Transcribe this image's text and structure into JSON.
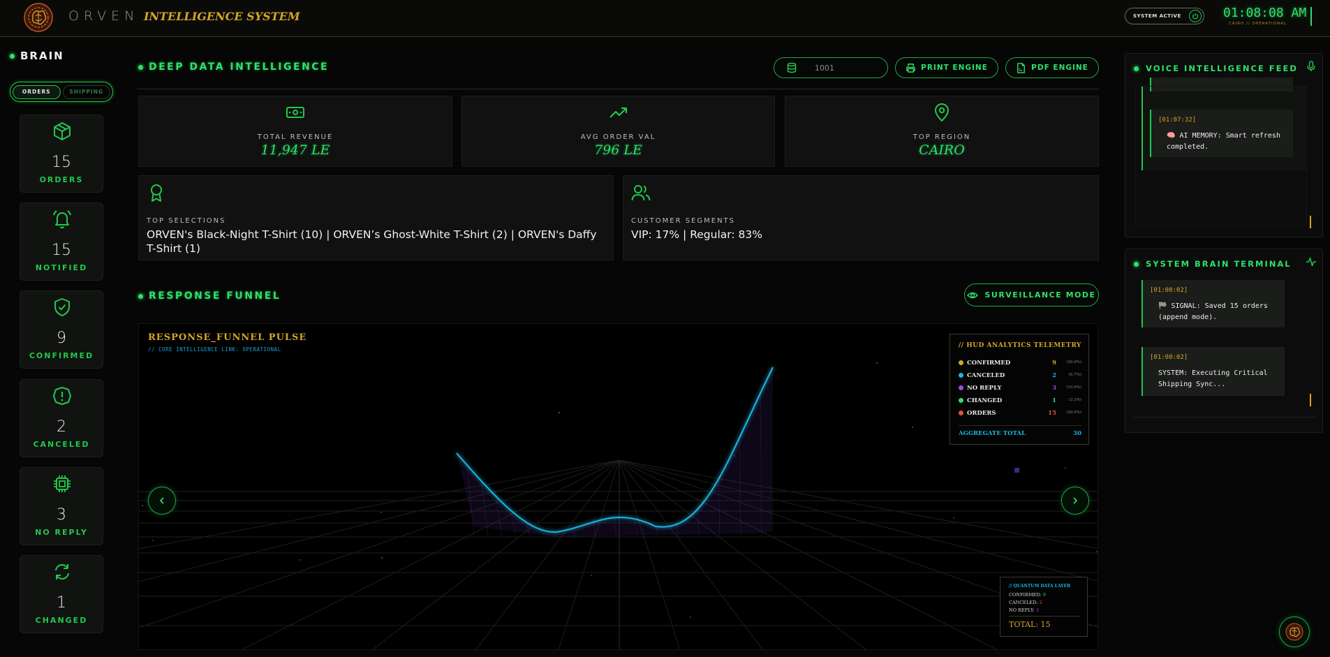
{
  "header": {
    "brand_main": "ORVEN",
    "brand_sub": "INTELLIGENCE SYSTEM",
    "logo_icon": "brain-orb-icon",
    "system_status": "SYSTEM ACTIVE",
    "clock": "01:08:08 AM",
    "clock_sub": "CAIRO // OPERATIONAL"
  },
  "sidebar": {
    "title": "BRAIN",
    "tabs": [
      {
        "label": "ORDERS",
        "active": true
      },
      {
        "label": "SHIPPING",
        "active": false
      }
    ],
    "stats": [
      {
        "value": "15",
        "label": "ORDERS",
        "icon": "box-icon"
      },
      {
        "value": "15",
        "label": "NOTIFIED",
        "icon": "bell-icon"
      },
      {
        "value": "9",
        "label": "CONFIRMED",
        "icon": "shield-check-icon"
      },
      {
        "value": "2",
        "label": "CANCELED",
        "icon": "alert-circle-icon"
      },
      {
        "value": "3",
        "label": "NO REPLY",
        "icon": "cpu-icon"
      },
      {
        "value": "1",
        "label": "CHANGED",
        "icon": "refresh-icon"
      }
    ]
  },
  "deep_data": {
    "title": "DEEP DATA INTELLIGENCE",
    "order_input_value": "1001",
    "print_button": "PRINT ENGINE",
    "pdf_button": "PDF ENGINE",
    "kpis": [
      {
        "label": "TOTAL REVENUE",
        "value": "11,947 LE",
        "icon": "banknote-icon"
      },
      {
        "label": "AVG ORDER VAL",
        "value": "796 LE",
        "icon": "trending-up-icon"
      },
      {
        "label": "TOP REGION",
        "value": "CAIRO",
        "icon": "map-pin-icon"
      }
    ],
    "top_selections": {
      "label": "TOP SELECTIONS",
      "value": "ORVEN's Black-Night T-Shirt (10) | ORVEN’s Ghost-White T-Shirt (2) | ORVEN's Daffy T-Shirt (1)"
    },
    "customer_segments": {
      "label": "CUSTOMER SEGMENTS",
      "value": "VIP: 17% | Regular: 83%"
    }
  },
  "funnel": {
    "title": "RESPONSE FUNNEL",
    "surveillance_button": "SURVEILLANCE MODE",
    "viz_title": "RESPONSE_FUNNEL PULSE",
    "viz_sub": "// CORE INTELLIGENCE LINK: OPERATIONAL",
    "hud": {
      "title": "// HUD ANALYTICS TELEMETRY",
      "rows": [
        {
          "label": "CONFIRMED",
          "value": "9",
          "pct": "(30.0%)",
          "color": "#d6a526"
        },
        {
          "label": "CANCELED",
          "value": "2",
          "pct": "(6.7%)",
          "color": "#19b8e0"
        },
        {
          "label": "NO REPLY",
          "value": "3",
          "pct": "(10.0%)",
          "color": "#9b4de0"
        },
        {
          "label": "CHANGED",
          "value": "1",
          "pct": "(3.3%)",
          "color": "#2fe06a"
        },
        {
          "label": "ORDERS",
          "value": "15",
          "pct": "(50.0%)",
          "color": "#e0583a"
        }
      ],
      "aggregate_label": "AGGREGATE TOTAL",
      "aggregate_value": "30"
    },
    "quantum": {
      "title": "// QUANTUM DATA LAYER",
      "confirmed_label": "CONFIRMED:",
      "confirmed": "9",
      "canceled_label": "CANCELED:",
      "canceled": "2",
      "noreply_label": "NO REPLY:",
      "noreply": "3",
      "total_label": "TOTAL:",
      "total": "15"
    }
  },
  "voice_feed": {
    "title": "VOICE INTELLIGENCE FEED",
    "icon": "mic-icon",
    "items": [
      {
        "time": "[01:07:32]",
        "message": "🧠 AI MEMORY: Smart refresh completed."
      }
    ]
  },
  "terminal": {
    "title": "SYSTEM BRAIN TERMINAL",
    "icon": "activity-icon",
    "items": [
      {
        "time": "[01:08:02]",
        "message": "🏁 SIGNAL: Saved 15 orders (append mode)."
      },
      {
        "time": "[01:08:02]",
        "message": "SYSTEM: Executing Critical Shipping Sync..."
      }
    ]
  },
  "colors": {
    "accent": "#2fe06a",
    "gold": "#d6a526",
    "cyan": "#19b8e0",
    "purple": "#9b4de0"
  }
}
